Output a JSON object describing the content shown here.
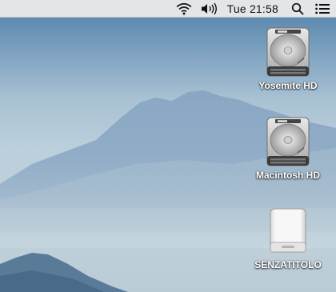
{
  "menubar": {
    "status_icons": [
      "wifi-icon",
      "volume-icon"
    ],
    "clock": "Tue 21:58",
    "right_icons": [
      "spotlight-search-icon",
      "notification-center-icon"
    ]
  },
  "desktop": {
    "drives": [
      {
        "label": "Yosemite HD",
        "icon": "hard-drive-icon"
      },
      {
        "label": "Macintosh HD",
        "icon": "hard-drive-icon"
      },
      {
        "label": "SENZATITOLO",
        "icon": "external-drive-icon"
      }
    ]
  },
  "colors": {
    "menubar_bg": "#eeeeee",
    "label_text": "#ffffff"
  }
}
